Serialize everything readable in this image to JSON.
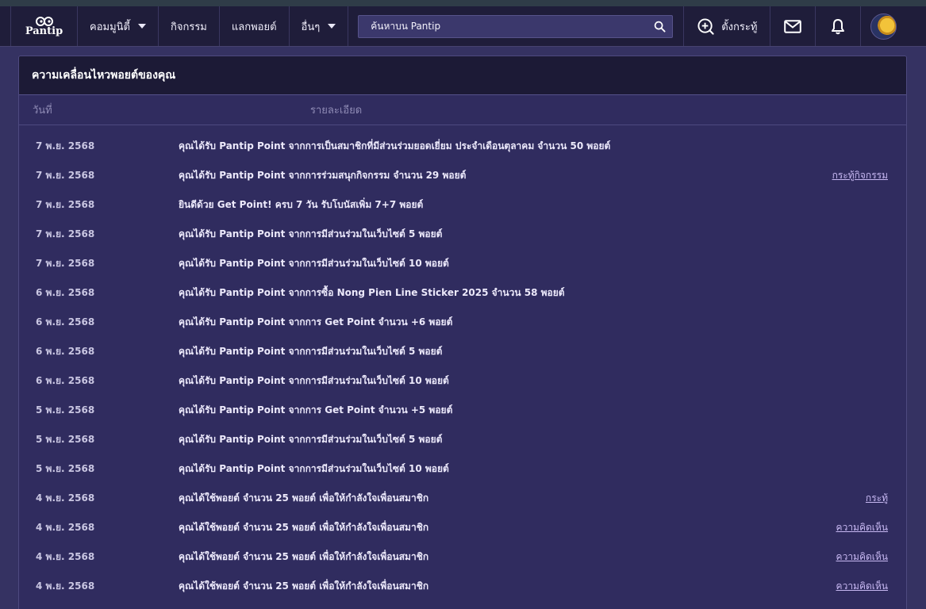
{
  "nav": {
    "logo_text": "Pantip",
    "menu": [
      {
        "label": "คอมมูนิตี้",
        "has_caret": true
      },
      {
        "label": "กิจกรรม",
        "has_caret": false
      },
      {
        "label": "แลกพอยต์",
        "has_caret": false
      },
      {
        "label": "อื่นๆ",
        "has_caret": true
      }
    ],
    "search_placeholder": "ค้นหาบน Pantip",
    "create_label": "ตั้งกระทู้",
    "icons": {
      "search": "search-icon",
      "create": "plus-circle-icon",
      "mail": "mail-icon",
      "bell": "bell-icon"
    }
  },
  "card": {
    "title": "ความเคลื่อนไหวพอยต์ของคุณ",
    "col_date": "วันที่",
    "col_detail": "รายละเอียด"
  },
  "rows": [
    {
      "date": "7 พ.ย. 2568",
      "detail": "คุณได้รับ Pantip Point จากการเป็นสมาชิกที่มีส่วนร่วมยอดเยี่ยม ประจำเดือนตุลาคม จำนวน 50 พอยต์",
      "link": ""
    },
    {
      "date": "7 พ.ย. 2568",
      "detail": "คุณได้รับ Pantip Point จากการร่วมสนุกกิจกรรม จำนวน 29 พอยต์",
      "link": "กระทู้กิจกรรม"
    },
    {
      "date": "7 พ.ย. 2568",
      "detail": "ยินดีด้วย Get Point! ครบ 7 วัน รับโบนัสเพิ่ม 7+7 พอยต์",
      "link": ""
    },
    {
      "date": "7 พ.ย. 2568",
      "detail": "คุณได้รับ Pantip Point จากการมีส่วนร่วมในเว็บไซต์ 5 พอยต์",
      "link": ""
    },
    {
      "date": "7 พ.ย. 2568",
      "detail": "คุณได้รับ Pantip Point จากการมีส่วนร่วมในเว็บไซต์ 10 พอยต์",
      "link": ""
    },
    {
      "date": "6 พ.ย. 2568",
      "detail": "คุณได้รับ Pantip Point จากการซื้อ Nong Pien Line Sticker 2025 จำนวน 58 พอยต์",
      "link": ""
    },
    {
      "date": "6 พ.ย. 2568",
      "detail": "คุณได้รับ Pantip Point จากการ Get Point จำนวน +6 พอยต์",
      "link": ""
    },
    {
      "date": "6 พ.ย. 2568",
      "detail": "คุณได้รับ Pantip Point จากการมีส่วนร่วมในเว็บไซต์ 5 พอยต์",
      "link": ""
    },
    {
      "date": "6 พ.ย. 2568",
      "detail": "คุณได้รับ Pantip Point จากการมีส่วนร่วมในเว็บไซต์ 10 พอยต์",
      "link": ""
    },
    {
      "date": "5 พ.ย. 2568",
      "detail": "คุณได้รับ Pantip Point จากการ Get Point จำนวน +5 พอยต์",
      "link": ""
    },
    {
      "date": "5 พ.ย. 2568",
      "detail": "คุณได้รับ Pantip Point จากการมีส่วนร่วมในเว็บไซต์ 5 พอยต์",
      "link": ""
    },
    {
      "date": "5 พ.ย. 2568",
      "detail": "คุณได้รับ Pantip Point จากการมีส่วนร่วมในเว็บไซต์ 10 พอยต์",
      "link": ""
    },
    {
      "date": "4 พ.ย. 2568",
      "detail": "คุณได้ใช้พอยต์ จำนวน 25 พอยต์ เพื่อให้กำลังใจเพื่อนสมาชิก",
      "link": "กระทู้"
    },
    {
      "date": "4 พ.ย. 2568",
      "detail": "คุณได้ใช้พอยต์ จำนวน 25 พอยต์ เพื่อให้กำลังใจเพื่อนสมาชิก",
      "link": "ความคิดเห็น"
    },
    {
      "date": "4 พ.ย. 2568",
      "detail": "คุณได้ใช้พอยต์ จำนวน 25 พอยต์ เพื่อให้กำลังใจเพื่อนสมาชิก",
      "link": "ความคิดเห็น"
    },
    {
      "date": "4 พ.ย. 2568",
      "detail": "คุณได้ใช้พอยต์ จำนวน 25 พอยต์ เพื่อให้กำลังใจเพื่อนสมาชิก",
      "link": "ความคิดเห็น"
    }
  ]
}
